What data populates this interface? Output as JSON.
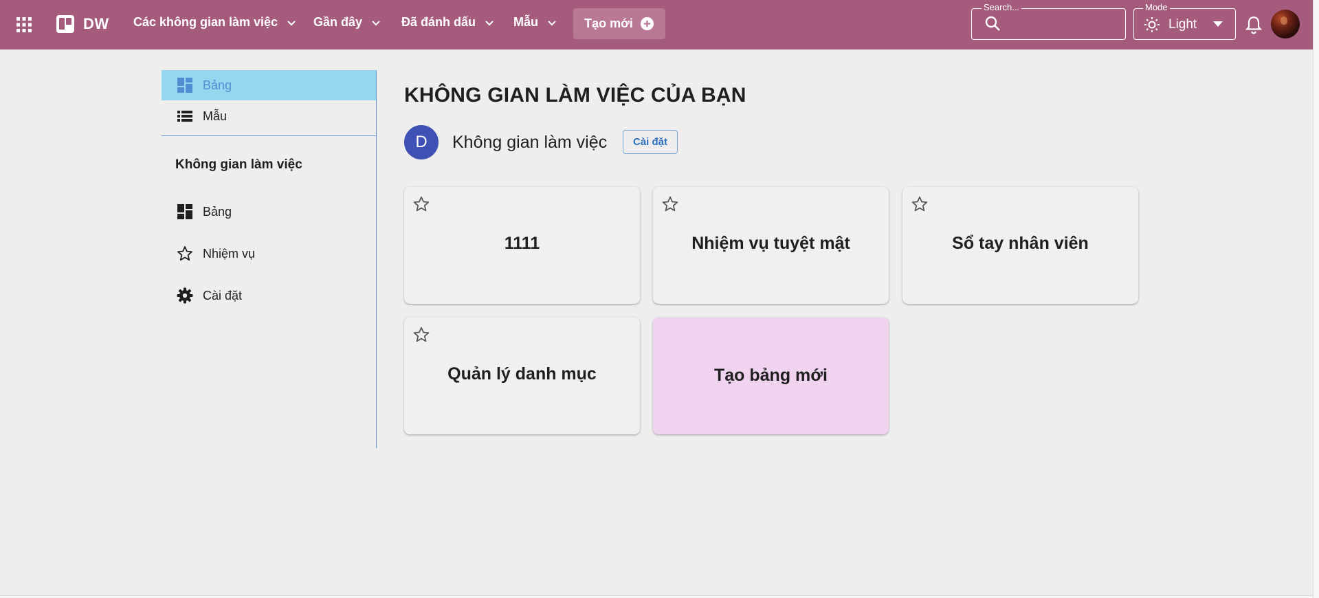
{
  "header": {
    "logo_text": "DW",
    "nav": [
      {
        "label": "Các không gian làm việc"
      },
      {
        "label": "Gần đây"
      },
      {
        "label": "Đã đánh dấu"
      },
      {
        "label": "Mẫu"
      }
    ],
    "create_label": "Tạo mới",
    "search": {
      "legend": "Search...",
      "value": ""
    },
    "mode": {
      "legend": "Mode",
      "value": "Light"
    },
    "colors": {
      "bar": "#a55c7c"
    }
  },
  "sidebar": {
    "top_items": [
      {
        "label": "Bảng",
        "icon": "dashboard-icon",
        "active": true
      },
      {
        "label": "Mẫu",
        "icon": "list-icon",
        "active": false
      }
    ],
    "section_title": "Không gian làm việc",
    "section_items": [
      {
        "label": "Bảng",
        "icon": "dashboard-icon"
      },
      {
        "label": "Nhiệm vụ",
        "icon": "star-icon"
      },
      {
        "label": "Cài đặt",
        "icon": "gear-icon"
      }
    ]
  },
  "main": {
    "title": "KHÔNG GIAN LÀM VIỆC CỦA BẠN",
    "workspace": {
      "avatar_letter": "D",
      "name": "Không gian làm việc",
      "settings_label": "Cài đặt"
    },
    "boards": [
      {
        "title": "1111"
      },
      {
        "title": "Nhiệm vụ tuyệt mật"
      },
      {
        "title": "Sổ tay nhân viên"
      },
      {
        "title": "Quản lý danh mục"
      }
    ],
    "create_board_label": "Tạo bảng mới"
  }
}
